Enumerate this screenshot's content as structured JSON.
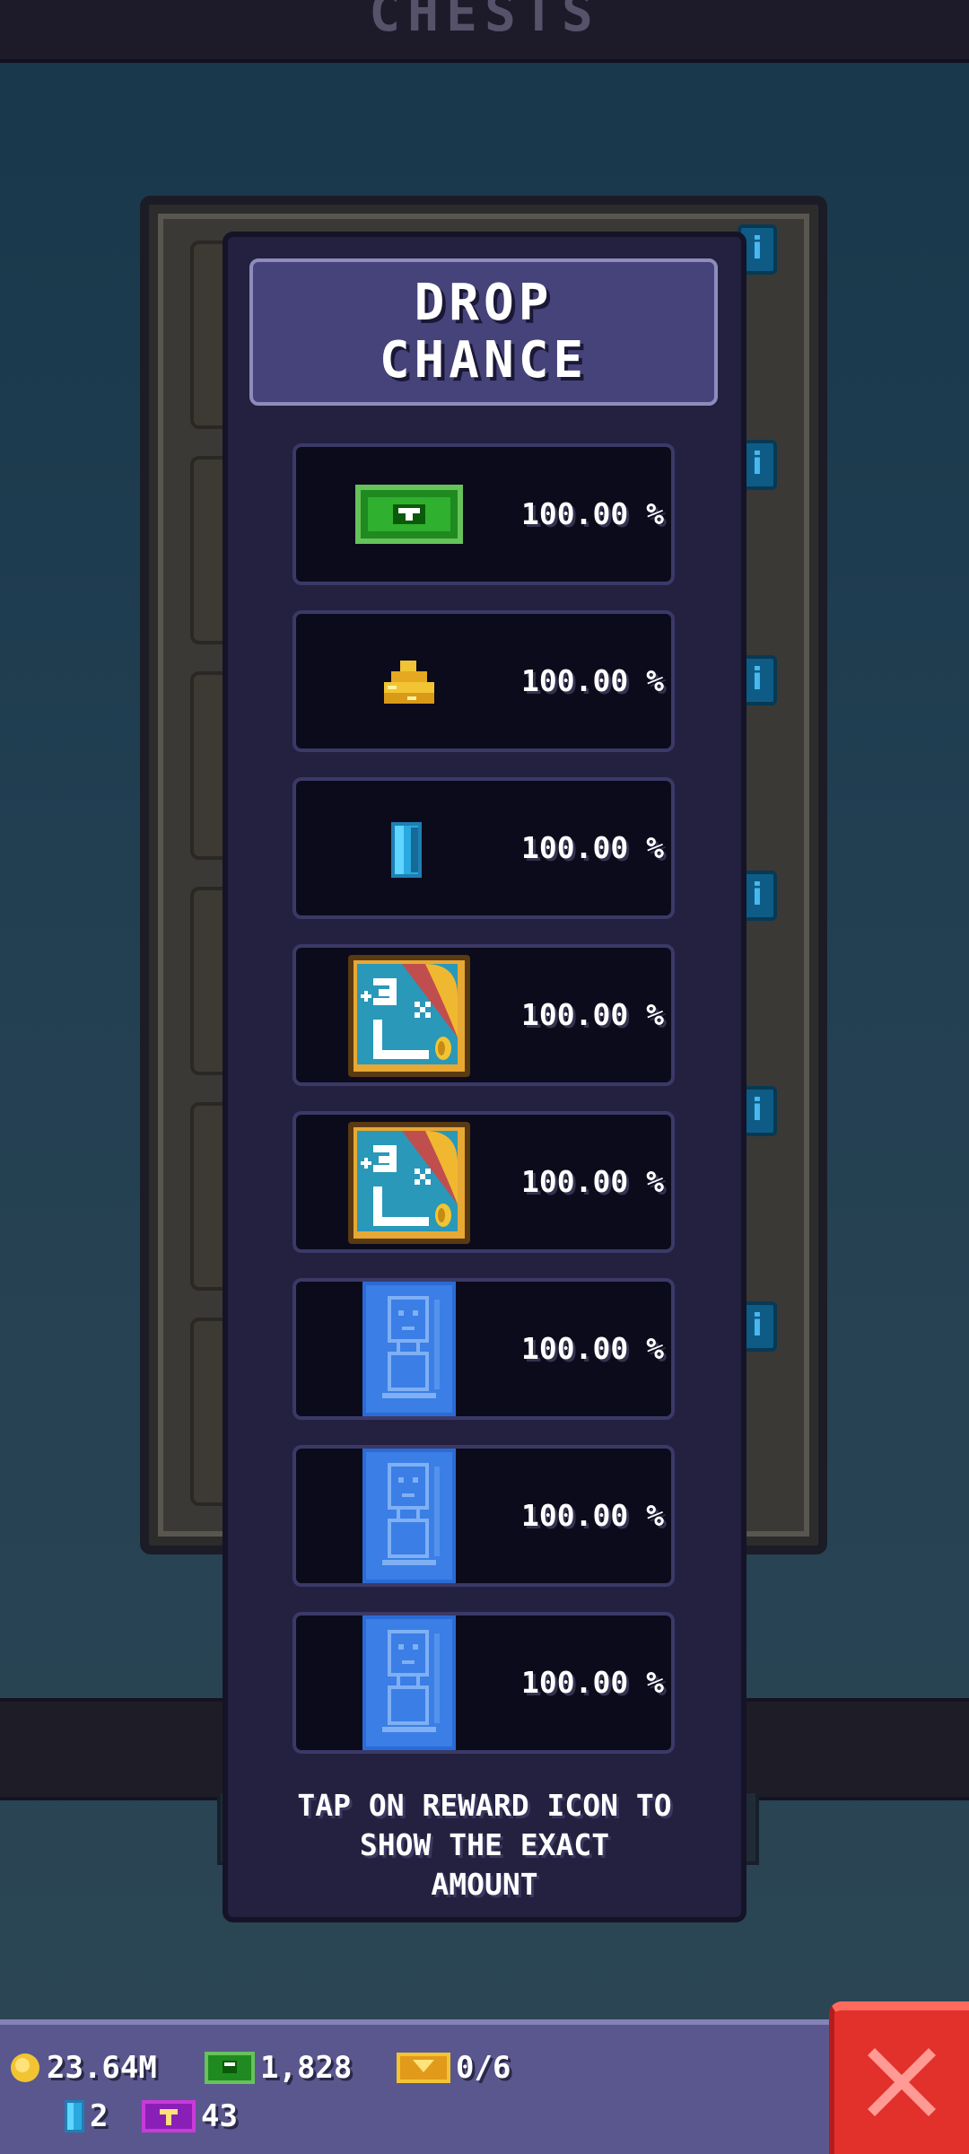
{
  "screen": {
    "title": "CHESTS"
  },
  "modal": {
    "title_line1": "DROP",
    "title_line2": "CHANCE",
    "rewards": [
      {
        "icon": "cash-bill-icon",
        "percent": "100.00 %"
      },
      {
        "icon": "gold-coins-icon",
        "percent": "100.00 %"
      },
      {
        "icon": "blue-gem-icon",
        "percent": "100.00 %"
      },
      {
        "icon": "multiplier-card-icon",
        "percent": "100.00 %"
      },
      {
        "icon": "multiplier-card-icon",
        "percent": "100.00 %"
      },
      {
        "icon": "blueprint-card-icon",
        "percent": "100.00 %"
      },
      {
        "icon": "blueprint-card-icon",
        "percent": "100.00 %"
      },
      {
        "icon": "blueprint-card-icon",
        "percent": "100.00 %"
      }
    ],
    "footer_line1": "TAP ON REWARD ICON TO",
    "footer_line2": "SHOW THE EXACT",
    "footer_line3": "AMOUNT"
  },
  "currencies": {
    "coins": "23.64M",
    "cash": "1,828",
    "tickets": "0/6",
    "gems": "2",
    "vip": "43"
  },
  "colors": {
    "accent_red": "#e2302b",
    "modal_bg": "#23213f",
    "cash_green": "#2fa52f",
    "gem_blue": "#2aa8e0"
  }
}
